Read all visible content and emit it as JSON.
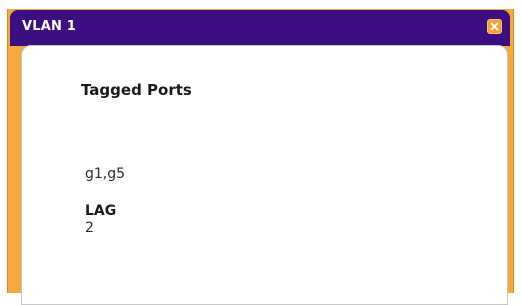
{
  "dialog": {
    "title": "VLAN 1",
    "close_icon": "close-icon",
    "accent_color": "#3d0d82",
    "frame_color": "#f3a93b"
  },
  "content": {
    "heading": "Tagged Ports",
    "tagged_ports_value": "g1,g5",
    "lag_label": "LAG",
    "lag_value": "2"
  }
}
